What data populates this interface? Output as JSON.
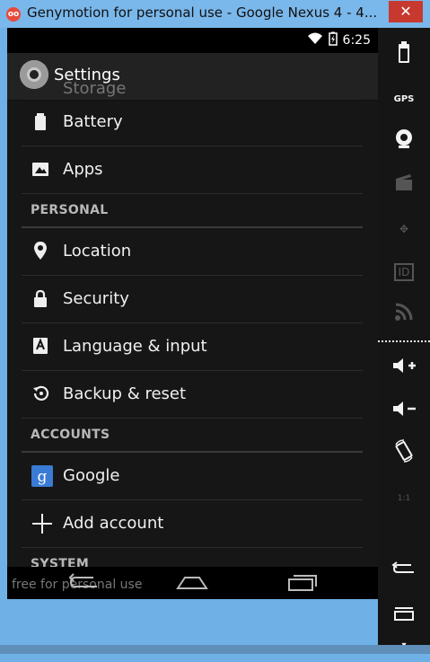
{
  "window": {
    "title": "Genymotion for personal use - Google Nexus 4 - 4...",
    "close_glyph": "✕"
  },
  "statusbar": {
    "time": "6:25",
    "icons": [
      "wifi-icon",
      "battery-icon"
    ]
  },
  "actionbar": {
    "title": "Settings",
    "icon": "gear-icon"
  },
  "list": {
    "partial_item": "Storage",
    "items_top": [
      {
        "label": "Battery",
        "icon": "battery-icon"
      },
      {
        "label": "Apps",
        "icon": "apps-icon"
      }
    ],
    "personal_header": "PERSONAL",
    "personal": [
      {
        "label": "Location",
        "icon": "location-icon"
      },
      {
        "label": "Security",
        "icon": "lock-icon"
      },
      {
        "label": "Language & input",
        "icon": "keyboard-icon"
      },
      {
        "label": "Backup & reset",
        "icon": "backup-icon"
      }
    ],
    "accounts_header": "ACCOUNTS",
    "accounts": [
      {
        "label": "Google",
        "icon": "google-icon"
      },
      {
        "label": "Add account",
        "icon": "plus-icon"
      }
    ],
    "system_header": "SYSTEM"
  },
  "navbar": {
    "watermark": "free for personal use"
  },
  "sidebar": {
    "buttons": [
      "battery-icon",
      "gps-icon",
      "camera-icon",
      "clapper-icon",
      "dpad-icon",
      "id-icon",
      "rss-icon",
      "volume-up-icon",
      "volume-down-icon",
      "rotate-icon",
      "scale-icon",
      "back-icon",
      "menu-icon"
    ],
    "gps_label": "GPS",
    "id_label": "ID",
    "scale_label": "1:1"
  }
}
